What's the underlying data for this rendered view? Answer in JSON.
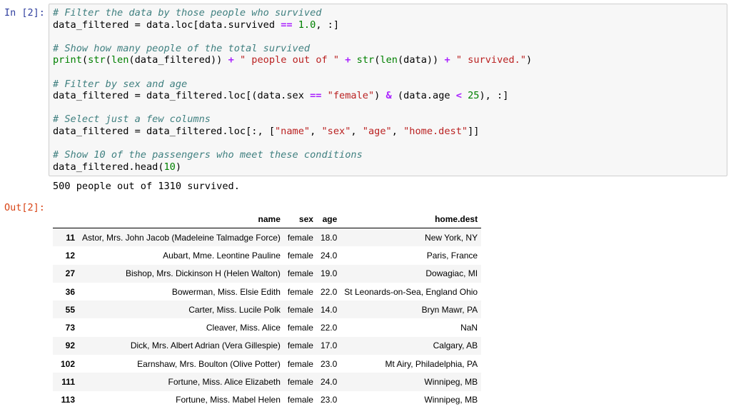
{
  "input_prompt": "In [2]:",
  "output_prompt": "Out[2]:",
  "code": {
    "l1": "# Filter the data by those people who survived",
    "l3": "# Show how many people of the total survived",
    "l6": "# Filter by sex and age",
    "l9": "# Select just a few columns",
    "l12": "# Show 10 of the passengers who meet these conditions",
    "s_people": "\" people out of \"",
    "s_survived": "\" survived.\"",
    "s_female": "\"female\"",
    "s_name": "\"name\"",
    "s_sex": "\"sex\"",
    "s_age": "\"age\"",
    "s_home": "\"home.dest\"",
    "n_10": "1.0",
    "n_25": "25",
    "n_head": "10"
  },
  "stdout": "500 people out of 1310 survived.",
  "table": {
    "columns": [
      "name",
      "sex",
      "age",
      "home.dest"
    ],
    "rows": [
      {
        "index": "11",
        "name": "Astor, Mrs. John Jacob (Madeleine Talmadge Force)",
        "sex": "female",
        "age": "18.0",
        "home": "New York, NY"
      },
      {
        "index": "12",
        "name": "Aubart, Mme. Leontine Pauline",
        "sex": "female",
        "age": "24.0",
        "home": "Paris, France"
      },
      {
        "index": "27",
        "name": "Bishop, Mrs. Dickinson H (Helen Walton)",
        "sex": "female",
        "age": "19.0",
        "home": "Dowagiac, MI"
      },
      {
        "index": "36",
        "name": "Bowerman, Miss. Elsie Edith",
        "sex": "female",
        "age": "22.0",
        "home": "St Leonards-on-Sea, England Ohio"
      },
      {
        "index": "55",
        "name": "Carter, Miss. Lucile Polk",
        "sex": "female",
        "age": "14.0",
        "home": "Bryn Mawr, PA"
      },
      {
        "index": "73",
        "name": "Cleaver, Miss. Alice",
        "sex": "female",
        "age": "22.0",
        "home": "NaN"
      },
      {
        "index": "92",
        "name": "Dick, Mrs. Albert Adrian (Vera Gillespie)",
        "sex": "female",
        "age": "17.0",
        "home": "Calgary, AB"
      },
      {
        "index": "102",
        "name": "Earnshaw, Mrs. Boulton (Olive Potter)",
        "sex": "female",
        "age": "23.0",
        "home": "Mt Airy, Philadelphia, PA"
      },
      {
        "index": "111",
        "name": "Fortune, Miss. Alice Elizabeth",
        "sex": "female",
        "age": "24.0",
        "home": "Winnipeg, MB"
      },
      {
        "index": "113",
        "name": "Fortune, Miss. Mabel Helen",
        "sex": "female",
        "age": "23.0",
        "home": "Winnipeg, MB"
      }
    ]
  }
}
